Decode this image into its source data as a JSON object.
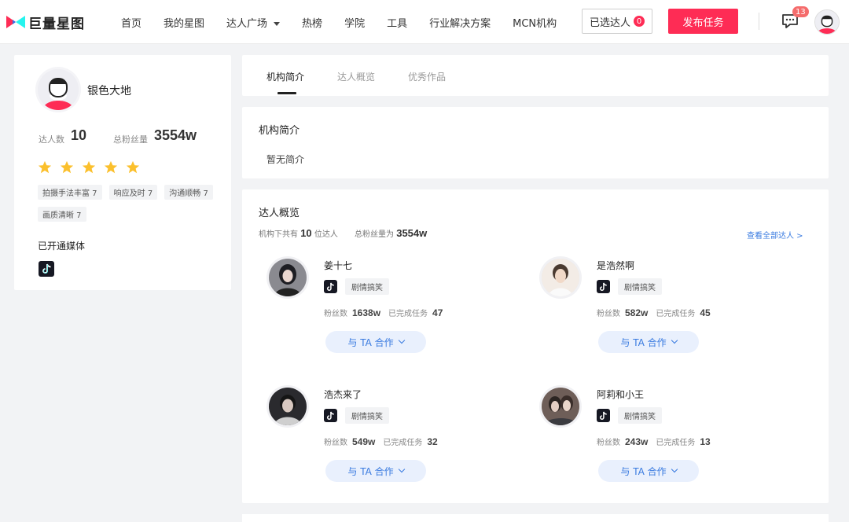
{
  "header": {
    "logo_text": "巨量星图",
    "nav": [
      "首页",
      "我的星图",
      "达人广场",
      "热榜",
      "学院",
      "工具",
      "行业解决方案",
      "MCN机构"
    ],
    "selected_label": "已选达人",
    "selected_count": "0",
    "publish_label": "发布任务",
    "message_count": "13"
  },
  "org": {
    "name": "银色大地",
    "kol_count_label": "达人数",
    "kol_count": "10",
    "fans_label": "总粉丝量",
    "fans": "3554w",
    "rating": 5,
    "tags": [
      "拍摄手法丰富 7",
      "响应及时 7",
      "沟通顺畅 7",
      "画质清晰 7"
    ],
    "media_title": "已开通媒体",
    "media": [
      "douyin"
    ]
  },
  "tabs": [
    "机构简介",
    "达人概览",
    "优秀作品"
  ],
  "intro": {
    "title": "机构简介",
    "text": "暂无简介"
  },
  "overview": {
    "title": "达人概览",
    "summary_prefix": "机构下共有",
    "summary_count": "10",
    "summary_mid": "位达人",
    "summary_fans_label": "总粉丝量为",
    "summary_fans": "3554w",
    "view_all": "查看全部达人 >",
    "coop_label": "与 TA 合作",
    "fans_label": "粉丝数",
    "tasks_label": "已完成任务",
    "kols": [
      {
        "name": "姜十七",
        "tag": "剧情搞笑",
        "fans": "1638w",
        "tasks": "47"
      },
      {
        "name": "是浩然啊",
        "tag": "剧情搞笑",
        "fans": "582w",
        "tasks": "45"
      },
      {
        "name": "浩杰来了",
        "tag": "剧情搞笑",
        "fans": "549w",
        "tasks": "32"
      },
      {
        "name": "阿莉和小王",
        "tag": "剧情搞笑",
        "fans": "243w",
        "tasks": "13"
      }
    ]
  },
  "colors": {
    "brand": "#fe2c55",
    "link": "#3a7be0",
    "star": "#fbc02d"
  }
}
